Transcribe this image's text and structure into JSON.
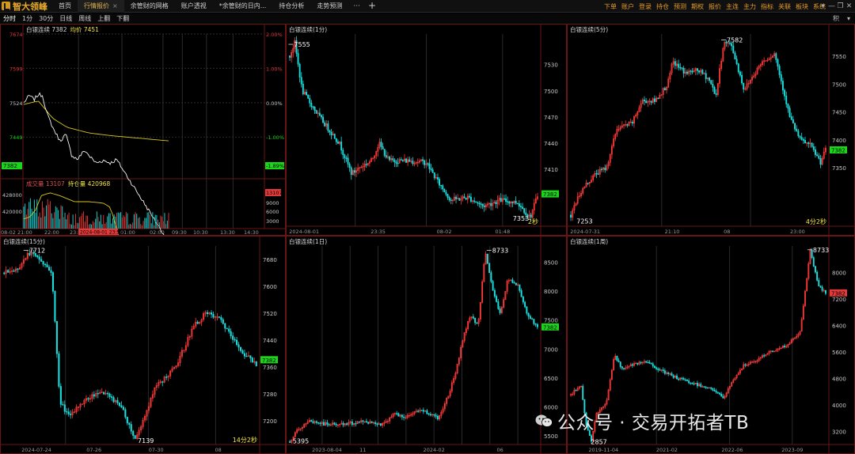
{
  "app": {
    "name": "智大领峰"
  },
  "tabs": [
    {
      "label": "首页",
      "active": false,
      "closable": false
    },
    {
      "label": "行情报价",
      "active": true,
      "closable": true
    },
    {
      "label": "余管财的网格",
      "active": false,
      "closable": false
    },
    {
      "label": "账户透视",
      "active": false,
      "closable": false
    },
    {
      "label": "*余管财的日内...",
      "active": false,
      "closable": false
    },
    {
      "label": "持仓分析",
      "active": false,
      "closable": false
    },
    {
      "label": "走势预测",
      "active": false,
      "closable": false
    }
  ],
  "tabs_more": "···",
  "tab_add": "+",
  "top_menu": [
    "下单",
    "账户",
    "登录",
    "持仓",
    "预测",
    "期权",
    "报价",
    "主连",
    "主力",
    "指标",
    "关联",
    "板块",
    "系统"
  ],
  "window_controls": [
    "▾",
    "—",
    "❐",
    "✕"
  ],
  "toolbar": [
    "分时",
    "1分",
    "30分",
    "日线",
    "周线",
    "上翻",
    "下翻"
  ],
  "toolbar_right": [
    "积",
    "▾"
  ],
  "colors": {
    "up": "#ff3b3b",
    "down": "#18e0e0",
    "avg": "#d8c81a",
    "frame": "#6a1515",
    "grid": "#262626",
    "label_yellow": "#f3e342",
    "green_tag": "#1ad61a",
    "red_tag": "#e23a3a"
  },
  "panels": {
    "intraday": {
      "title": "白银连续 7382",
      "avg_label": "均价 7451",
      "y_left": [
        "7674",
        "7599",
        "7524",
        "7449",
        "7382"
      ],
      "y_right": [
        "2.00%",
        "1.00%",
        "0.00%",
        "-1.00%",
        "-1.89%"
      ],
      "current_tag": "7382",
      "current_pct_tag": "-1.89%",
      "vol_title": "成交量 13107",
      "oi_title": "持仓量 420968",
      "vol_left": [
        "428000",
        "420000"
      ],
      "vol_right": [
        "13107",
        "9000",
        "6000",
        "3000"
      ],
      "x_labels": [
        "08-02",
        "21:00",
        "22:00",
        "23:0",
        "01:00",
        "02:00",
        "09:30",
        "10:30",
        "13:30",
        "14:30"
      ],
      "cursor_time": "2024-08-01 23:58"
    },
    "m1": {
      "title": "白银连续(1分)",
      "y": [
        "7530",
        "7500",
        "7470",
        "7440",
        "7410",
        "7382"
      ],
      "tag": "7382",
      "high": "7555",
      "low": "7353",
      "countdown": "2秒",
      "x_labels": [
        "2024-08-01",
        "23:35",
        "08-02",
        "01:48"
      ]
    },
    "m5": {
      "title": "白银连续(5分)",
      "y": [
        "7550",
        "7500",
        "7450",
        "7400",
        "7382",
        "7350"
      ],
      "tag": "7382",
      "high": "7582",
      "low": "7253",
      "countdown": "4分2秒",
      "x_labels": [
        "2024-07-31",
        "21:10",
        "08",
        "23:00"
      ]
    },
    "m15": {
      "title": "白银连续(15分)",
      "y": [
        "7680",
        "7600",
        "7520",
        "7440",
        "7382",
        "7360",
        "7280",
        "7200"
      ],
      "tag": "7382",
      "high": "7712",
      "low": "7139",
      "countdown": "14分2秒",
      "x_labels": [
        "2024-07-24",
        "07-26",
        "07-30",
        "08"
      ]
    },
    "d1": {
      "title": "白银连续(1日)",
      "y": [
        "8500",
        "8000",
        "7500",
        "7382",
        "7000",
        "6500",
        "6000",
        "5500"
      ],
      "tag": "7382",
      "high": "8733",
      "low": "5395",
      "x_labels": [
        "2023-08-04",
        "11",
        "2024-02",
        "06"
      ]
    },
    "w1": {
      "title": "白银连续(1周)",
      "y": [
        "8000",
        "7382",
        "7200",
        "6400",
        "5600",
        "4800",
        "4000",
        "3200"
      ],
      "tag": "7382",
      "high": "8733",
      "low": "2857",
      "x_labels": [
        "2019-11-04",
        "2021-02",
        "2022-06",
        "2023-09"
      ]
    }
  },
  "watermark": "公众号 · 交易开拓者TB"
}
